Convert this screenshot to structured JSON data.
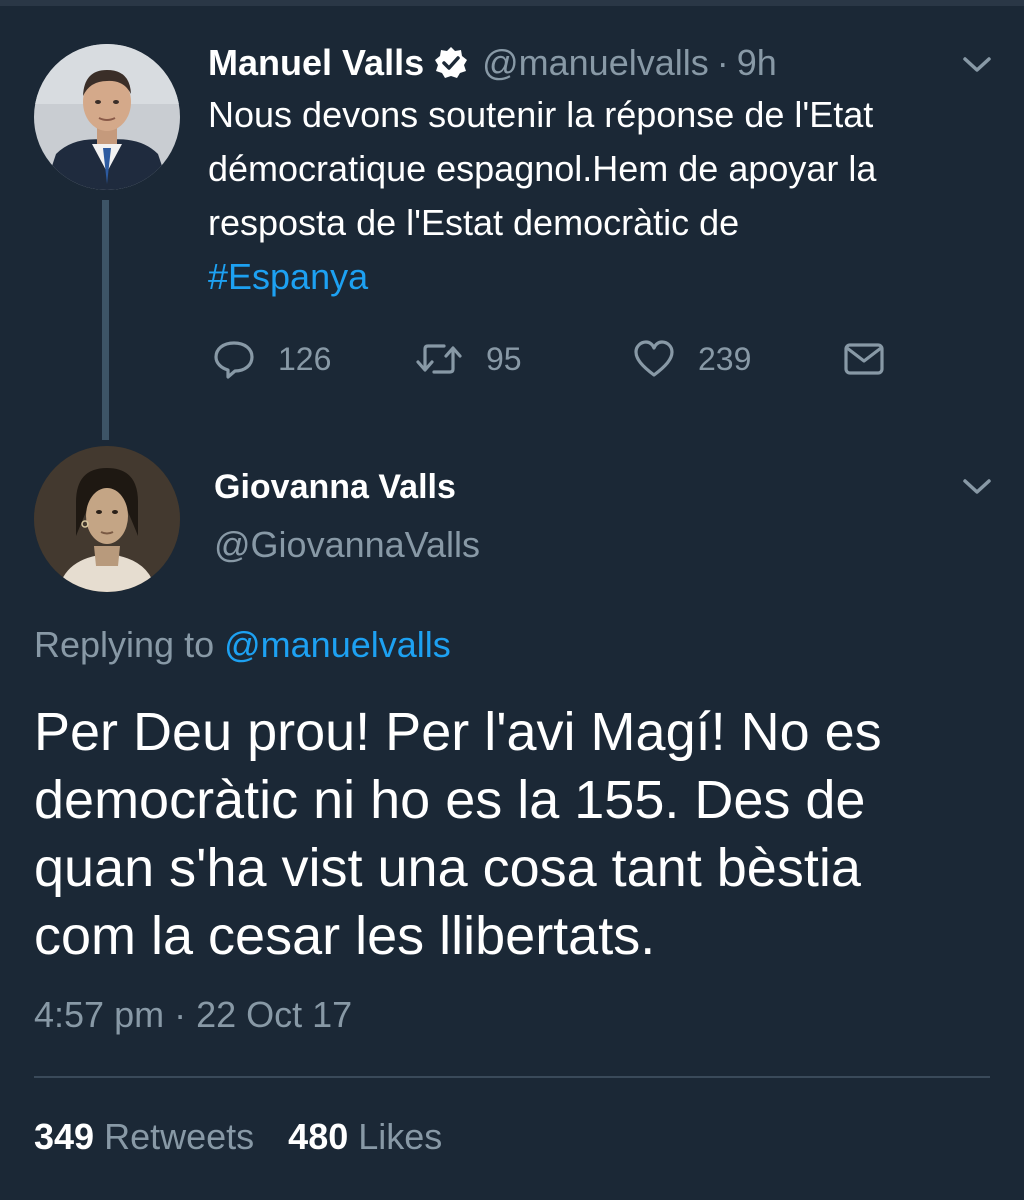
{
  "tweet1": {
    "name": "Manuel Valls",
    "handle": "@manuelvalls",
    "separator": "·",
    "time": "9h",
    "text_lines": [
      "Nous devons soutenir la réponse de l'Etat",
      "démocratique espagnol.Hem de apoyar la",
      "resposta de l'Estat democràtic de"
    ],
    "hashtag": "#Espanya",
    "replies": "126",
    "retweets": "95",
    "likes": "239",
    "verified": true,
    "icons": [
      "verified-badge-icon",
      "chevron-down-icon",
      "reply-icon",
      "retweet-icon",
      "like-icon",
      "direct-message-icon"
    ]
  },
  "tweet2": {
    "name": "Giovanna Valls",
    "handle": "@GiovannaValls",
    "replying_prefix": "Replying to",
    "replying_to": "@manuelvalls",
    "text_lines": [
      "Per Deu prou! Per l'avi Magí! No es",
      "democràtic ni ho es la 155. Des de",
      "quan s'ha vist una cosa tant bèstia",
      "com la cesar les llibertats."
    ],
    "timestamp": "4:57 pm · 22 Oct 17",
    "retweet_count": "349",
    "retweet_label": "Retweets",
    "like_count": "480",
    "like_label": "Likes"
  },
  "colors": {
    "background": "#1b2836",
    "text_primary": "#ffffff",
    "text_secondary": "#8899a6",
    "accent": "#1da1f2",
    "thread_line": "#3d5466"
  }
}
